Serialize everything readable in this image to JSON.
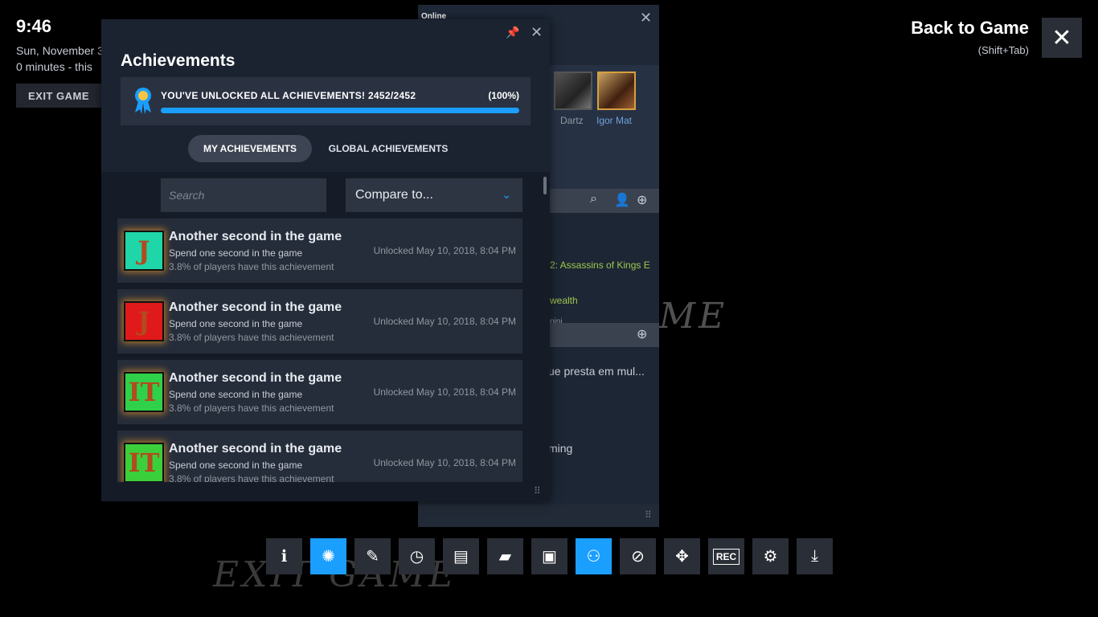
{
  "overlay": {
    "clock": "9:46",
    "date": "Sun, November 3",
    "session": "0 minutes - this",
    "exit_label": "EXIT GAME",
    "back_title": "Back to Game",
    "back_hint": "(Shift+Tab)",
    "close_icon": "close-icon"
  },
  "background": {
    "scribble_right": "ME",
    "scribble_bottom": "EXIT GAME"
  },
  "friends": {
    "status_text": "Online",
    "avatars": [
      {
        "name": "Dartz"
      },
      {
        "name": "Igor Mat"
      }
    ],
    "games": [
      "2: Assassins of Kings E",
      "wealth",
      "nini"
    ],
    "chats": [
      "ue presta em mul...",
      "ming"
    ]
  },
  "achievements": {
    "title": "Achievements",
    "unlock_text": "YOU'VE UNLOCKED ALL ACHIEVEMENTS! 2452/2452",
    "unlock_pct": "(100%)",
    "progress_fraction": 1.0,
    "tabs": {
      "mine": "MY ACHIEVEMENTS",
      "global": "GLOBAL ACHIEVEMENTS"
    },
    "search_placeholder": "Search",
    "compare_label": "Compare to...",
    "items": [
      {
        "name": "Another second in the game",
        "desc": "Spend one second in the game",
        "pct": "3.8% of players have this achievement",
        "date": "Unlocked May 10, 2018, 8:04 PM",
        "bg": "#1fd6a8",
        "glyph": "J"
      },
      {
        "name": "Another second in the game",
        "desc": "Spend one second in the game",
        "pct": "3.8% of players have this achievement",
        "date": "Unlocked May 10, 2018, 8:04 PM",
        "bg": "#e01a1a",
        "glyph": "J"
      },
      {
        "name": "Another second in the game",
        "desc": "Spend one second in the game",
        "pct": "3.8% of players have this achievement",
        "date": "Unlocked May 10, 2018, 8:04 PM",
        "bg": "#2fd14a",
        "glyph": "IT"
      },
      {
        "name": "Another second in the game",
        "desc": "Spend one second in the game",
        "pct": "3.8% of players have this achievement",
        "date": "Unlocked May 10, 2018, 8:04 PM",
        "bg": "#3ccf3c",
        "glyph": "IT"
      }
    ]
  },
  "taskbar": [
    {
      "icon": "info-icon",
      "glyph": "ℹ",
      "active": false
    },
    {
      "icon": "achievements-icon",
      "glyph": "✺",
      "active": true
    },
    {
      "icon": "notes-icon",
      "glyph": "✎",
      "active": false
    },
    {
      "icon": "timer-icon",
      "glyph": "◷",
      "active": false
    },
    {
      "icon": "guides-icon",
      "glyph": "▤",
      "active": false
    },
    {
      "icon": "discussions-icon",
      "glyph": "▰",
      "active": false
    },
    {
      "icon": "screenshots-icon",
      "glyph": "▣",
      "active": false
    },
    {
      "icon": "friends-icon",
      "glyph": "⚇",
      "active": true
    },
    {
      "icon": "browser-icon",
      "glyph": "⊘",
      "active": false
    },
    {
      "icon": "controller-icon",
      "glyph": "✥",
      "active": false
    },
    {
      "icon": "recording-icon",
      "glyph": "REC",
      "active": false
    },
    {
      "icon": "settings-icon",
      "glyph": "⚙",
      "active": false
    },
    {
      "icon": "downloads-icon",
      "glyph": "⤓",
      "active": false
    }
  ],
  "colors": {
    "accent": "#1a9fff",
    "panel": "#1b2331"
  }
}
